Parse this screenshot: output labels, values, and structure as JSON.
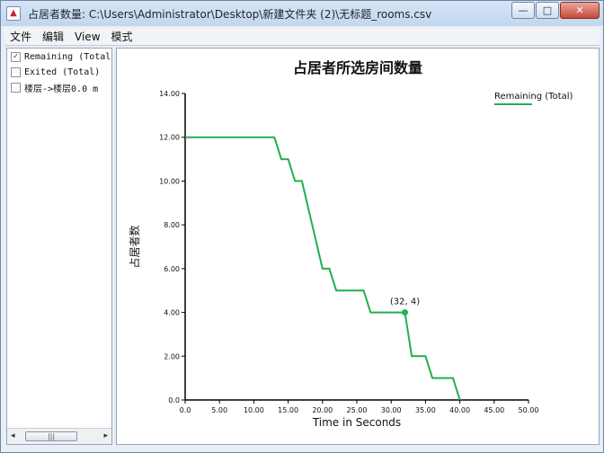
{
  "window": {
    "title": "占居者数量: C:\\Users\\Administrator\\Desktop\\新建文件夹 (2)\\无标题_rooms.csv",
    "controls": {
      "minimize": "—",
      "maximize": "□",
      "close": "✕"
    }
  },
  "menu": [
    "文件",
    "编辑",
    "View",
    "模式"
  ],
  "series_list": [
    {
      "label": "Remaining (Total)",
      "checked": true
    },
    {
      "label": "Exited (Total)",
      "checked": false
    },
    {
      "label": "楼层->楼层0.0 m",
      "checked": false
    }
  ],
  "scrollbar": {
    "left": "◂",
    "right": "▸",
    "grip": "|||"
  },
  "chart_data": {
    "type": "line",
    "title": "占居者所选房间数量",
    "xlabel": "Time in Seconds",
    "ylabel": "占居者数",
    "xlim": [
      0,
      50
    ],
    "ylim": [
      0,
      14
    ],
    "xticks": [
      "0.0",
      "5.00",
      "10.00",
      "15.00",
      "20.00",
      "25.00",
      "30.00",
      "35.00",
      "40.00",
      "45.00",
      "50.00"
    ],
    "yticks": [
      "0.0",
      "2.00",
      "4.00",
      "6.00",
      "8.00",
      "10.00",
      "12.00",
      "14.00"
    ],
    "legend_position": "top-right",
    "series": [
      {
        "name": "Remaining (Total)",
        "color": "#1fb050",
        "x": [
          0,
          13,
          14,
          15,
          16,
          17,
          20,
          21,
          22,
          23,
          26,
          27,
          31,
          32,
          33,
          35,
          36,
          39,
          40
        ],
        "y": [
          12,
          12,
          11,
          11,
          10,
          10,
          6,
          6,
          5,
          5,
          5,
          4,
          4,
          4,
          2,
          2,
          1,
          1,
          0
        ]
      }
    ],
    "annotation": {
      "label": "(32, 4)",
      "x": 32,
      "y": 4
    }
  }
}
